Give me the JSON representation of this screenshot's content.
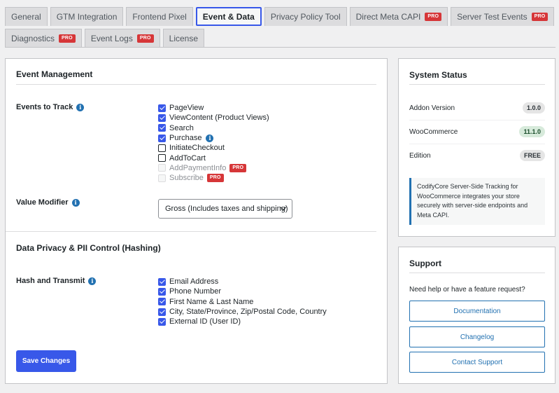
{
  "tabs": {
    "row1": [
      {
        "label": "General",
        "pro": false,
        "active": false
      },
      {
        "label": "GTM Integration",
        "pro": false,
        "active": false
      },
      {
        "label": "Frontend Pixel",
        "pro": false,
        "active": false
      },
      {
        "label": "Event & Data",
        "pro": false,
        "active": true
      },
      {
        "label": "Privacy Policy Tool",
        "pro": false,
        "active": false
      },
      {
        "label": "Direct Meta CAPI",
        "pro": true,
        "active": false
      },
      {
        "label": "Server Test Events",
        "pro": true,
        "active": false
      }
    ],
    "row2": [
      {
        "label": "Diagnostics",
        "pro": true,
        "active": false
      },
      {
        "label": "Event Logs",
        "pro": true,
        "active": false
      },
      {
        "label": "License",
        "pro": false,
        "active": false
      }
    ],
    "pro_label": "PRO"
  },
  "event_management": {
    "title": "Event Management",
    "events_label": "Events to Track",
    "events": [
      {
        "label": "PageView",
        "state": "checked",
        "pro": false,
        "info": false
      },
      {
        "label": "ViewContent (Product Views)",
        "state": "checked",
        "pro": false,
        "info": false
      },
      {
        "label": "Search",
        "state": "checked",
        "pro": false,
        "info": false
      },
      {
        "label": "Purchase",
        "state": "checked",
        "pro": false,
        "info": true
      },
      {
        "label": "InitiateCheckout",
        "state": "unchecked",
        "pro": false,
        "info": false
      },
      {
        "label": "AddToCart",
        "state": "unchecked",
        "pro": false,
        "info": false
      },
      {
        "label": "AddPaymentInfo",
        "state": "disabled",
        "pro": true,
        "info": false
      },
      {
        "label": "Subscribe",
        "state": "disabled",
        "pro": true,
        "info": false
      }
    ],
    "value_modifier_label": "Value Modifier",
    "value_modifier_selected": "Gross (Includes taxes and shipping)"
  },
  "privacy": {
    "title": "Data Privacy & PII Control (Hashing)",
    "hash_label": "Hash and Transmit",
    "fields": [
      {
        "label": "Email Address",
        "state": "checked"
      },
      {
        "label": "Phone Number",
        "state": "checked"
      },
      {
        "label": "First Name & Last Name",
        "state": "checked"
      },
      {
        "label": "City, State/Province, Zip/Postal Code, Country",
        "state": "checked"
      },
      {
        "label": "External ID (User ID)",
        "state": "checked"
      }
    ]
  },
  "save_button": "Save Changes",
  "system_status": {
    "title": "System Status",
    "rows": [
      {
        "label": "Addon Version",
        "value": "1.0.0",
        "color": "#e5e5e5"
      },
      {
        "label": "WooCommerce",
        "value": "11.1.0",
        "color": "#d7eadb"
      },
      {
        "label": "Edition",
        "value": "FREE",
        "color": "#e5e5e5"
      }
    ],
    "note": "CodifyCore Server-Side Tracking for WooCommerce integrates your store securely with server-side endpoints and Meta CAPI."
  },
  "support": {
    "title": "Support",
    "text": "Need help or have a feature request?",
    "buttons": [
      "Documentation",
      "Changelog",
      "Contact Support"
    ]
  },
  "colors": {
    "accent": "#3858e9",
    "pro_badge": "#d63638",
    "link": "#2271b1"
  }
}
